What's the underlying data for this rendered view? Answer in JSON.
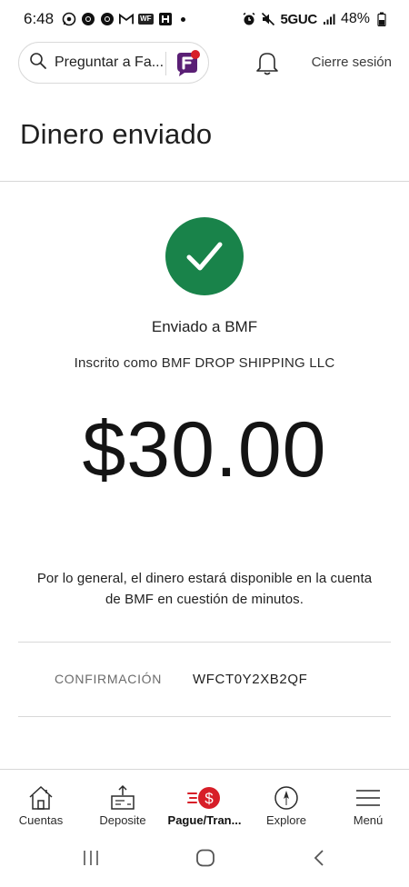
{
  "status_bar": {
    "time": "6:48",
    "network": "5GUC",
    "battery": "48%",
    "notification_icons": [
      "whatsapp-icon",
      "chrome-icon",
      "chrome-icon",
      "gmail-icon",
      "wf-icon",
      "hotel-app-icon"
    ]
  },
  "header": {
    "search_placeholder": "Preguntar a Fa...",
    "logout_label": "Cierre sesión"
  },
  "page": {
    "title": "Dinero enviado"
  },
  "confirmation": {
    "sent_to": "Enviado a BMF",
    "enrolled_as": "Inscrito como BMF DROP SHIPPING LLC",
    "amount": "$30.00",
    "note": "Por lo general, el dinero estará disponible en la cuenta de BMF en cuestión de minutos.",
    "confirmation_label": "CONFIRMACIÓN",
    "confirmation_code": "WFCT0Y2XB2QF"
  },
  "bottom_nav": {
    "items": [
      {
        "label": "Cuentas",
        "icon": "home-icon"
      },
      {
        "label": "Deposite",
        "icon": "deposit-icon"
      },
      {
        "label": "Pague/Tran...",
        "icon": "pay-transfer-icon"
      },
      {
        "label": "Explore",
        "icon": "compass-icon"
      },
      {
        "label": "Menú",
        "icon": "hamburger-menu-icon"
      }
    ],
    "active_index": 2
  },
  "colors": {
    "success_green": "#19834a",
    "accent_red": "#d71e28",
    "fargo_purple": "#5a1f75"
  }
}
